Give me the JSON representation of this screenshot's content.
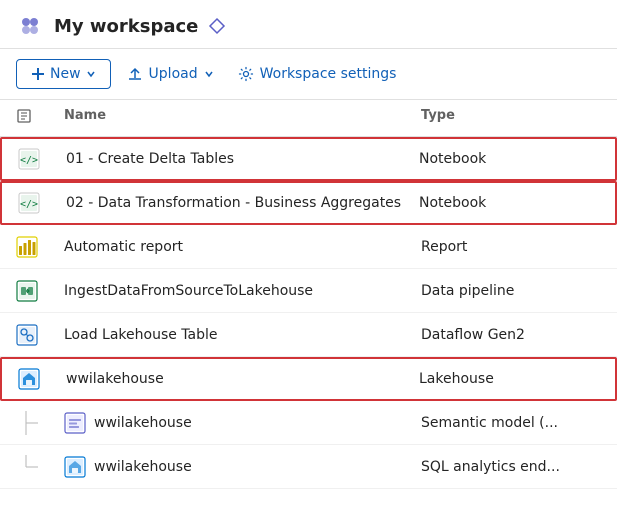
{
  "header": {
    "workspace_name": "My workspace",
    "diamond_char": "◇"
  },
  "toolbar": {
    "new_label": "New",
    "new_chevron": "∨",
    "upload_label": "Upload",
    "upload_chevron": "∨",
    "settings_label": "Workspace settings"
  },
  "table": {
    "col_name": "Name",
    "col_type": "Type",
    "rows": [
      {
        "id": "row1",
        "name": "01 - Create Delta Tables",
        "type": "Notebook",
        "icon": "notebook",
        "highlighted": true,
        "indent": 0
      },
      {
        "id": "row2",
        "name": "02 - Data Transformation - Business Aggregates",
        "type": "Notebook",
        "icon": "notebook",
        "highlighted": true,
        "indent": 0
      },
      {
        "id": "row3",
        "name": "Automatic report",
        "type": "Report",
        "icon": "report",
        "highlighted": false,
        "indent": 0
      },
      {
        "id": "row4",
        "name": "IngestDataFromSourceToLakehouse",
        "type": "Data pipeline",
        "icon": "pipeline",
        "highlighted": false,
        "indent": 0
      },
      {
        "id": "row5",
        "name": "Load Lakehouse Table",
        "type": "Dataflow Gen2",
        "icon": "dataflow",
        "highlighted": false,
        "indent": 0
      },
      {
        "id": "row6",
        "name": "wwilakehouse",
        "type": "Lakehouse",
        "icon": "lakehouse",
        "highlighted": true,
        "indent": 0
      },
      {
        "id": "row7",
        "name": "wwilakehouse",
        "type": "Semantic model (...",
        "icon": "semantic",
        "highlighted": false,
        "indent": 1
      },
      {
        "id": "row8",
        "name": "wwilakehouse",
        "type": "SQL analytics end...",
        "icon": "sql",
        "highlighted": false,
        "indent": 1
      }
    ]
  }
}
